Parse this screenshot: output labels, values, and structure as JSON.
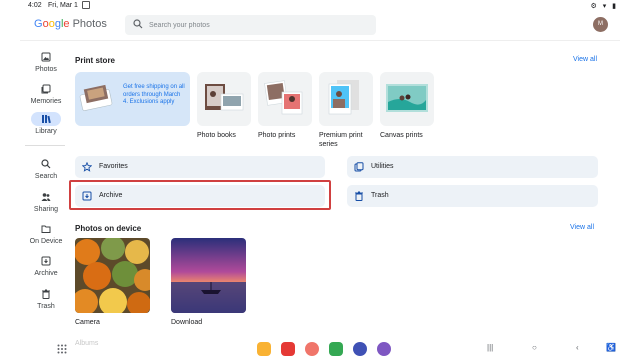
{
  "status": {
    "time": "4:02",
    "date": "Fri, Mar 1"
  },
  "app": {
    "logo_parts": [
      "G",
      "o",
      "o",
      "g",
      "l",
      "e"
    ],
    "logo_product": "Photos",
    "search_placeholder": "Search your photos",
    "avatar_initial": "M"
  },
  "nav": {
    "items": [
      {
        "label": "Photos",
        "icon": "photo-icon"
      },
      {
        "label": "Memories",
        "icon": "memories-icon"
      },
      {
        "label": "Library",
        "icon": "library-icon",
        "active": true
      },
      {
        "label": "Search",
        "icon": "search-icon"
      },
      {
        "label": "Sharing",
        "icon": "sharing-icon"
      },
      {
        "label": "On Device",
        "icon": "folder-icon"
      },
      {
        "label": "Archive",
        "icon": "archive-icon"
      },
      {
        "label": "Trash",
        "icon": "trash-icon"
      }
    ]
  },
  "print_store": {
    "title": "Print store",
    "view_all": "View all",
    "promo_text": "Get free shipping on all orders through March 4. Exclusions apply",
    "cards": [
      {
        "label": "Photo books"
      },
      {
        "label": "Photo prints"
      },
      {
        "label": "Premium print series"
      },
      {
        "label": "Canvas prints"
      }
    ]
  },
  "collections": {
    "favorites": "Favorites",
    "utilities": "Utilities",
    "archive": "Archive",
    "trash": "Trash"
  },
  "on_device": {
    "title": "Photos on device",
    "view_all": "View all",
    "folders": [
      {
        "label": "Camera"
      },
      {
        "label": "Download"
      }
    ],
    "next_section": "Albums"
  },
  "colors": {
    "accent": "#1a73e8",
    "tile_bg": "#edf2f7",
    "highlight": "#d04040"
  }
}
